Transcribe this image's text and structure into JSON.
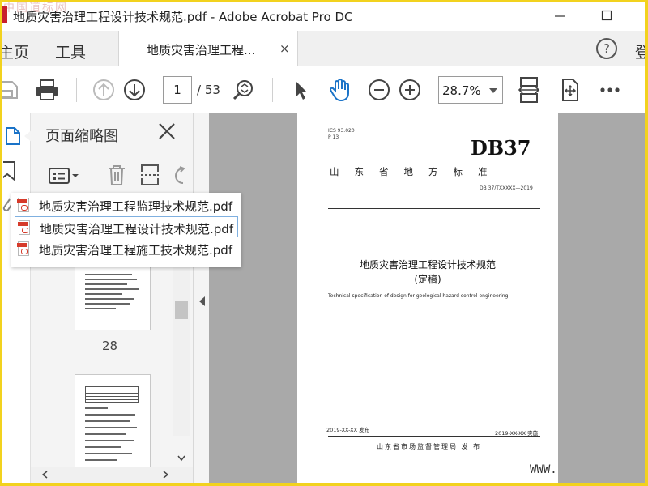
{
  "window": {
    "title": "地质灾害治理工程设计技术规范.pdf - Adobe Acrobat Pro DC",
    "watermark": "中国道标网"
  },
  "tabs": {
    "home": "主页",
    "tools": "工具",
    "document_tab": "地质灾害治理工程...",
    "close_glyph": "×",
    "help_glyph": "?",
    "signin": "登"
  },
  "toolbar": {
    "current_page": "1",
    "page_total": "/ 53",
    "zoom": "28.7%"
  },
  "panel": {
    "title": "页面缩略图",
    "thumbnail_page_number": "28"
  },
  "attachments": [
    {
      "name": "地质灾害治理工程监理技术规范.pdf"
    },
    {
      "name": "地质灾害治理工程设计技术规范.pdf"
    },
    {
      "name": "地质灾害治理工程施工技术规范.pdf"
    }
  ],
  "document": {
    "ics_line": "ICS 93.020",
    "p_line": "P 13",
    "standard_code": "DB37",
    "standard_type": "山东省地方标准",
    "standard_number": "DB 37/TXXXXX—2019",
    "title_cn": "地质灾害治理工程设计技术规范",
    "title_note": "(定稿)",
    "title_en": "Technical specification of design for geological hazard control engineering",
    "publish_date": "2019-XX-XX 发布",
    "implement_date": "2019-XX-XX 实施",
    "issuer": "山东省市场监督管理局    发 布"
  },
  "footer": {
    "www": "WWW."
  },
  "colors": {
    "accent_blue": "#1a73c8",
    "frame_yellow": "#f2d21e",
    "pdf_red": "#d63a2a"
  }
}
